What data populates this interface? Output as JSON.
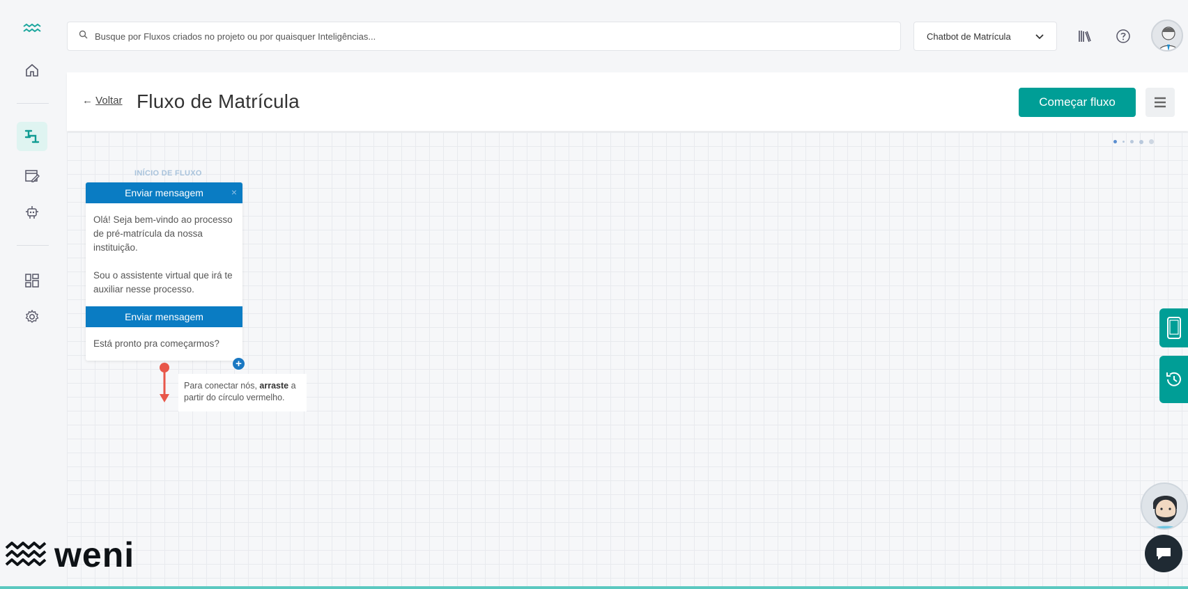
{
  "search": {
    "placeholder": "Busque por Fluxos criados no projeto ou por quaisquer Inteligências..."
  },
  "project_select": {
    "value": "Chatbot de Matrícula"
  },
  "header": {
    "back_label": "Voltar",
    "back_arrow": "←",
    "title": "Fluxo de Matrícula",
    "start_button": "Começar fluxo"
  },
  "canvas": {
    "flow_start_label": "INÍCIO DE FLUXO",
    "node": {
      "blocks": [
        {
          "title": "Enviar mensagem",
          "text": "Olá! Seja bem-vindo ao processo de pré-matrícula da nossa instituição.\n\nSou o assistente virtual que irá te auxiliar nesse processo."
        },
        {
          "title": "Enviar mensagem",
          "text": "Está pronto pra começarmos?"
        }
      ],
      "close_symbol": "×",
      "add_symbol": "+"
    },
    "hint": {
      "part1": "Para conectar nós, ",
      "bold": "arraste",
      "part2": " a partir do círculo vermelho."
    }
  },
  "brand": {
    "logo_text": "weni"
  },
  "colors": {
    "accent": "#009e96",
    "node_header": "#0a7cc3",
    "connector": "#e8574a"
  }
}
